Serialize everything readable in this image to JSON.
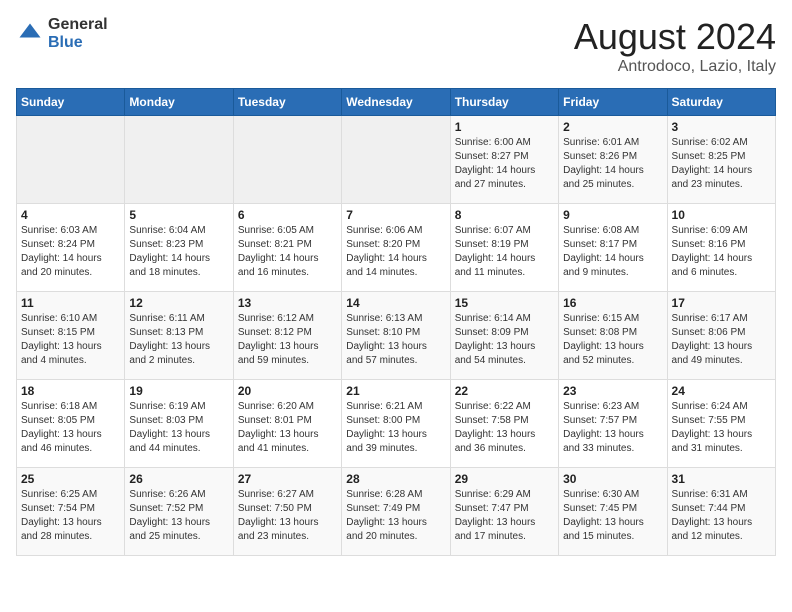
{
  "header": {
    "logo_general": "General",
    "logo_blue": "Blue",
    "month": "August 2024",
    "location": "Antrodoco, Lazio, Italy"
  },
  "days_of_week": [
    "Sunday",
    "Monday",
    "Tuesday",
    "Wednesday",
    "Thursday",
    "Friday",
    "Saturday"
  ],
  "weeks": [
    [
      {
        "day": "",
        "sunrise": "",
        "sunset": "",
        "daylight": ""
      },
      {
        "day": "",
        "sunrise": "",
        "sunset": "",
        "daylight": ""
      },
      {
        "day": "",
        "sunrise": "",
        "sunset": "",
        "daylight": ""
      },
      {
        "day": "",
        "sunrise": "",
        "sunset": "",
        "daylight": ""
      },
      {
        "day": "1",
        "sunrise": "6:00 AM",
        "sunset": "8:27 PM",
        "daylight": "14 hours and 27 minutes."
      },
      {
        "day": "2",
        "sunrise": "6:01 AM",
        "sunset": "8:26 PM",
        "daylight": "14 hours and 25 minutes."
      },
      {
        "day": "3",
        "sunrise": "6:02 AM",
        "sunset": "8:25 PM",
        "daylight": "14 hours and 23 minutes."
      }
    ],
    [
      {
        "day": "4",
        "sunrise": "6:03 AM",
        "sunset": "8:24 PM",
        "daylight": "14 hours and 20 minutes."
      },
      {
        "day": "5",
        "sunrise": "6:04 AM",
        "sunset": "8:23 PM",
        "daylight": "14 hours and 18 minutes."
      },
      {
        "day": "6",
        "sunrise": "6:05 AM",
        "sunset": "8:21 PM",
        "daylight": "14 hours and 16 minutes."
      },
      {
        "day": "7",
        "sunrise": "6:06 AM",
        "sunset": "8:20 PM",
        "daylight": "14 hours and 14 minutes."
      },
      {
        "day": "8",
        "sunrise": "6:07 AM",
        "sunset": "8:19 PM",
        "daylight": "14 hours and 11 minutes."
      },
      {
        "day": "9",
        "sunrise": "6:08 AM",
        "sunset": "8:17 PM",
        "daylight": "14 hours and 9 minutes."
      },
      {
        "day": "10",
        "sunrise": "6:09 AM",
        "sunset": "8:16 PM",
        "daylight": "14 hours and 6 minutes."
      }
    ],
    [
      {
        "day": "11",
        "sunrise": "6:10 AM",
        "sunset": "8:15 PM",
        "daylight": "13 hours and 4 minutes."
      },
      {
        "day": "12",
        "sunrise": "6:11 AM",
        "sunset": "8:13 PM",
        "daylight": "13 hours and 2 minutes."
      },
      {
        "day": "13",
        "sunrise": "6:12 AM",
        "sunset": "8:12 PM",
        "daylight": "13 hours and 59 minutes."
      },
      {
        "day": "14",
        "sunrise": "6:13 AM",
        "sunset": "8:10 PM",
        "daylight": "13 hours and 57 minutes."
      },
      {
        "day": "15",
        "sunrise": "6:14 AM",
        "sunset": "8:09 PM",
        "daylight": "13 hours and 54 minutes."
      },
      {
        "day": "16",
        "sunrise": "6:15 AM",
        "sunset": "8:08 PM",
        "daylight": "13 hours and 52 minutes."
      },
      {
        "day": "17",
        "sunrise": "6:17 AM",
        "sunset": "8:06 PM",
        "daylight": "13 hours and 49 minutes."
      }
    ],
    [
      {
        "day": "18",
        "sunrise": "6:18 AM",
        "sunset": "8:05 PM",
        "daylight": "13 hours and 46 minutes."
      },
      {
        "day": "19",
        "sunrise": "6:19 AM",
        "sunset": "8:03 PM",
        "daylight": "13 hours and 44 minutes."
      },
      {
        "day": "20",
        "sunrise": "6:20 AM",
        "sunset": "8:01 PM",
        "daylight": "13 hours and 41 minutes."
      },
      {
        "day": "21",
        "sunrise": "6:21 AM",
        "sunset": "8:00 PM",
        "daylight": "13 hours and 39 minutes."
      },
      {
        "day": "22",
        "sunrise": "6:22 AM",
        "sunset": "7:58 PM",
        "daylight": "13 hours and 36 minutes."
      },
      {
        "day": "23",
        "sunrise": "6:23 AM",
        "sunset": "7:57 PM",
        "daylight": "13 hours and 33 minutes."
      },
      {
        "day": "24",
        "sunrise": "6:24 AM",
        "sunset": "7:55 PM",
        "daylight": "13 hours and 31 minutes."
      }
    ],
    [
      {
        "day": "25",
        "sunrise": "6:25 AM",
        "sunset": "7:54 PM",
        "daylight": "13 hours and 28 minutes."
      },
      {
        "day": "26",
        "sunrise": "6:26 AM",
        "sunset": "7:52 PM",
        "daylight": "13 hours and 25 minutes."
      },
      {
        "day": "27",
        "sunrise": "6:27 AM",
        "sunset": "7:50 PM",
        "daylight": "13 hours and 23 minutes."
      },
      {
        "day": "28",
        "sunrise": "6:28 AM",
        "sunset": "7:49 PM",
        "daylight": "13 hours and 20 minutes."
      },
      {
        "day": "29",
        "sunrise": "6:29 AM",
        "sunset": "7:47 PM",
        "daylight": "13 hours and 17 minutes."
      },
      {
        "day": "30",
        "sunrise": "6:30 AM",
        "sunset": "7:45 PM",
        "daylight": "13 hours and 15 minutes."
      },
      {
        "day": "31",
        "sunrise": "6:31 AM",
        "sunset": "7:44 PM",
        "daylight": "13 hours and 12 minutes."
      }
    ]
  ]
}
